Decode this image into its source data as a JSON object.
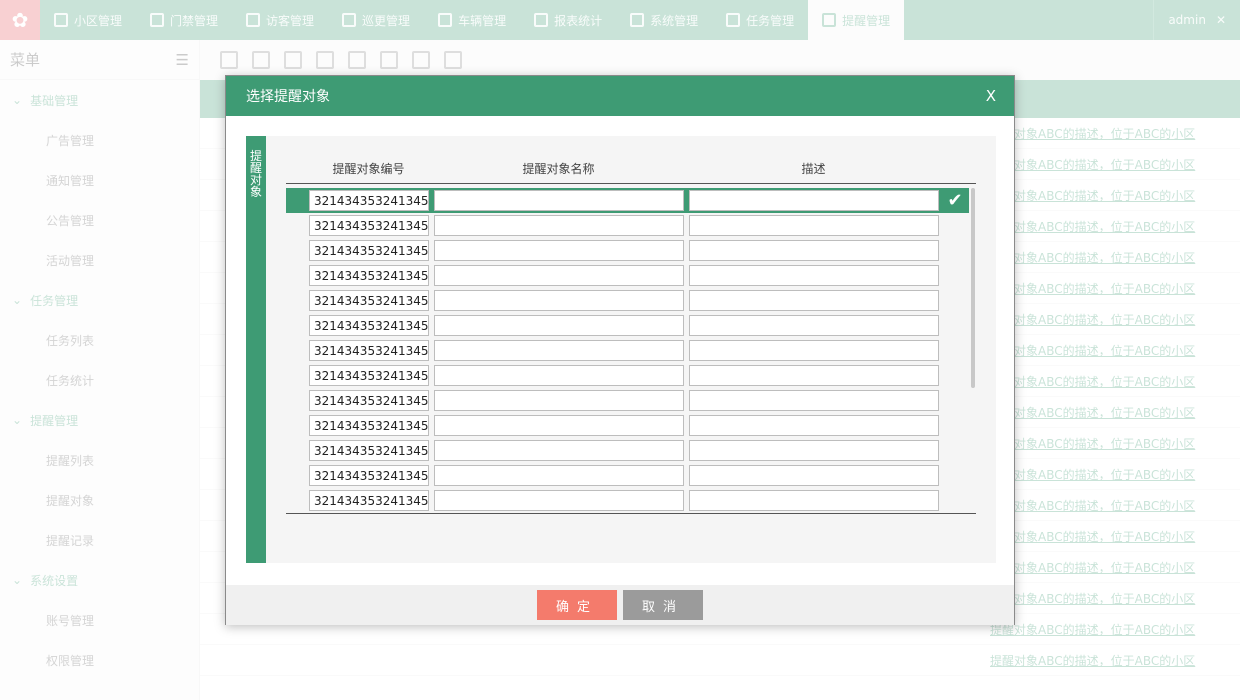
{
  "app": {
    "nav_tabs": [
      {
        "label": "小区管理"
      },
      {
        "label": "门禁管理"
      },
      {
        "label": "访客管理"
      },
      {
        "label": "巡更管理"
      },
      {
        "label": "车辆管理"
      },
      {
        "label": "报表统计"
      },
      {
        "label": "系统管理"
      },
      {
        "label": "任务管理"
      },
      {
        "label": "提醒管理"
      }
    ],
    "user": "admin",
    "sidebar": {
      "title": "菜单",
      "groups": [
        {
          "label": "基础管理",
          "items": [
            "广告管理",
            "通知管理",
            "公告管理",
            "活动管理"
          ]
        },
        {
          "label": "任务管理",
          "items": [
            "任务列表",
            "任务统计"
          ]
        },
        {
          "label": "提醒管理",
          "items": [
            "提醒列表",
            "提醒对象",
            "提醒记录"
          ]
        },
        {
          "label": "系统设置",
          "items": [
            "账号管理",
            "权限管理"
          ]
        }
      ]
    },
    "bg_link_text": "提醒对象ABC的描述，位于ABC的小区"
  },
  "modal": {
    "title": "选择提醒对象",
    "close_label": "X",
    "side_label": "提醒对象",
    "columns": [
      "提醒对象编号",
      "提醒对象名称",
      "描述"
    ],
    "rows": [
      {
        "code": "321434353241345",
        "name": "",
        "desc": "",
        "selected": true
      },
      {
        "code": "321434353241345",
        "name": "",
        "desc": ""
      },
      {
        "code": "321434353241345",
        "name": "",
        "desc": ""
      },
      {
        "code": "321434353241345",
        "name": "",
        "desc": ""
      },
      {
        "code": "321434353241345",
        "name": "",
        "desc": ""
      },
      {
        "code": "321434353241345",
        "name": "",
        "desc": ""
      },
      {
        "code": "321434353241345",
        "name": "",
        "desc": ""
      },
      {
        "code": "321434353241345",
        "name": "",
        "desc": ""
      },
      {
        "code": "321434353241345",
        "name": "",
        "desc": ""
      },
      {
        "code": "321434353241345",
        "name": "",
        "desc": ""
      },
      {
        "code": "321434353241345",
        "name": "",
        "desc": ""
      },
      {
        "code": "321434353241345",
        "name": "",
        "desc": ""
      },
      {
        "code": "321434353241345",
        "name": "",
        "desc": ""
      }
    ],
    "ok_label": "确定",
    "cancel_label": "取消"
  },
  "colors": {
    "accent": "#3e9b74",
    "ok": "#f47b6c",
    "cancel": "#9b9b9b"
  }
}
